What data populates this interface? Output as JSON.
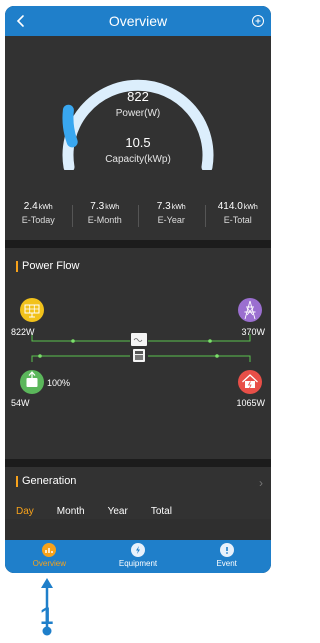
{
  "header": {
    "title": "Overview",
    "back_icon": "chevron-left-icon",
    "add_icon": "plus-circle-icon"
  },
  "gauge": {
    "power_value": "822",
    "power_label": "Power(W)",
    "capacity_value": "10.5",
    "capacity_label": "Capacity(kWp)",
    "fill_fraction": 0.12,
    "track_color": "#dceefc",
    "fill_color": "#39a7f0"
  },
  "stats": [
    {
      "value": "2.4",
      "unit": "kWh",
      "label": "E-Today"
    },
    {
      "value": "7.3",
      "unit": "kWh",
      "label": "E-Month"
    },
    {
      "value": "7.3",
      "unit": "kWh",
      "label": "E-Year"
    },
    {
      "value": "414.0",
      "unit": "kWh",
      "label": "E-Total"
    }
  ],
  "power_flow": {
    "title": "Power Flow",
    "solar": {
      "value": "822W",
      "icon": "solar-panel-icon",
      "color": "#f2c21b"
    },
    "grid": {
      "value": "370W",
      "icon": "power-tower-icon",
      "color": "#9b6fd0"
    },
    "battery": {
      "value": "54W",
      "soc": "100%",
      "icon": "battery-icon",
      "color": "#5bb75b"
    },
    "load": {
      "value": "1065W",
      "icon": "home-icon",
      "color": "#e84f48"
    },
    "line_color": "#5bc34e"
  },
  "generation": {
    "title": "Generation",
    "tabs": [
      "Day",
      "Month",
      "Year",
      "Total"
    ],
    "active_tab": "Day"
  },
  "bottom_nav": [
    {
      "label": "Overview",
      "icon": "chart-icon",
      "active": true
    },
    {
      "label": "Equipment",
      "icon": "bolt-icon",
      "active": false
    },
    {
      "label": "Event",
      "icon": "alert-icon",
      "active": false
    }
  ],
  "callout": {
    "number": "1",
    "color": "#1f7fca"
  },
  "colors": {
    "accent": "#1f7fca",
    "highlight": "#f7a21b",
    "panel": "#323232"
  }
}
